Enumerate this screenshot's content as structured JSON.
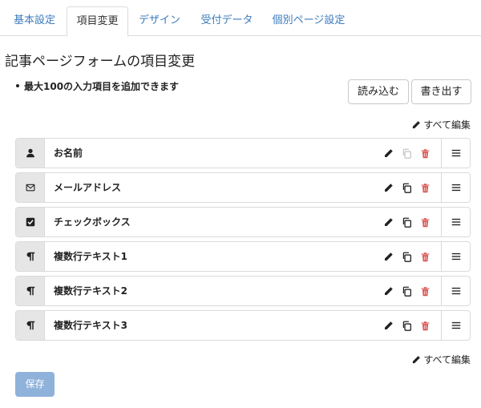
{
  "tabs": [
    {
      "label": "基本設定",
      "active": false
    },
    {
      "label": "項目変更",
      "active": true
    },
    {
      "label": "デザイン",
      "active": false
    },
    {
      "label": "受付データ",
      "active": false
    },
    {
      "label": "個別ページ設定",
      "active": false
    }
  ],
  "page_title": "記事ページフォームの項目変更",
  "notice": "最大100の入力項目を追加できます",
  "buttons": {
    "load": "読み込む",
    "export": "書き出す",
    "save": "保存"
  },
  "edit_all": "すべて編集",
  "fields": [
    {
      "label": "お名前",
      "icon": "user-icon",
      "copy_disabled": true
    },
    {
      "label": "メールアドレス",
      "icon": "envelope-icon",
      "copy_disabled": false
    },
    {
      "label": "チェックボックス",
      "icon": "checkbox-icon",
      "copy_disabled": false
    },
    {
      "label": "複数行テキスト1",
      "icon": "paragraph-icon",
      "copy_disabled": false
    },
    {
      "label": "複数行テキスト2",
      "icon": "paragraph-icon",
      "copy_disabled": false
    },
    {
      "label": "複数行テキスト3",
      "icon": "paragraph-icon",
      "copy_disabled": false
    }
  ],
  "colors": {
    "link": "#3b7bbd",
    "delete": "#d9534f",
    "save": "#8fb2da"
  }
}
